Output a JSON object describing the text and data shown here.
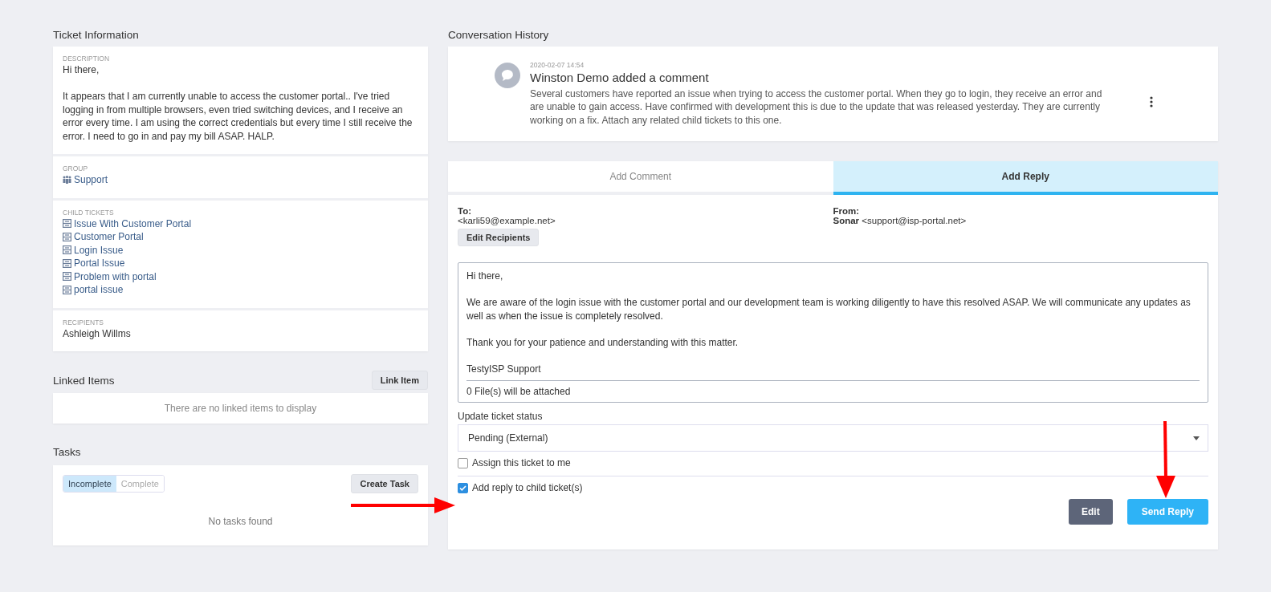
{
  "ticket_information": {
    "title": "Ticket Information",
    "description": {
      "label": "DESCRIPTION",
      "text": "Hi there,\n\nIt appears that I am currently unable to access the customer portal.. I've tried logging in from multiple browsers, even tried switching devices, and I receive an error every time. I am using the correct credentials but every time I still receive the error. I need to go in and pay my bill ASAP. HALP."
    },
    "group": {
      "label": "GROUP",
      "value": "Support"
    },
    "child_tickets": {
      "label": "CHILD TICKETS",
      "items": [
        "Issue With Customer Portal",
        "Customer Portal",
        "Login Issue",
        "Portal Issue",
        "Problem with portal",
        "portal issue"
      ]
    },
    "recipients": {
      "label": "RECIPIENTS",
      "value": "Ashleigh Willms"
    }
  },
  "linked_items": {
    "title": "Linked Items",
    "button": "Link Item",
    "empty": "There are no linked items to display"
  },
  "tasks": {
    "title": "Tasks",
    "filters": [
      {
        "label": "Incomplete",
        "selected": true
      },
      {
        "label": "Complete",
        "selected": false
      }
    ],
    "button": "Create Task",
    "empty": "No tasks found"
  },
  "conversation": {
    "title": "Conversation History",
    "entry": {
      "time": "2020-02-07 14:54",
      "heading": "Winston Demo added a comment",
      "text": "Several customers have reported an issue when trying to access the customer portal. When they go to login, they receive an error and are unable to gain access. Have confirmed with development this is due to the update that was released yesterday. They are currently working on a fix. Attach any related child tickets to this one."
    }
  },
  "reply": {
    "tabs": [
      {
        "label": "Add Comment",
        "selected": false
      },
      {
        "label": "Add Reply",
        "selected": true
      }
    ],
    "to_label": "To:",
    "to": "<karli59@example.net>",
    "edit_recipients": "Edit Recipients",
    "from_label": "From:",
    "from_name": "Sonar",
    "from": "<support@isp-portal.net>",
    "message": "Hi there,\n\nWe are aware of the login issue with the customer portal and our development team is working diligently to have this resolved ASAP. We will communicate any updates as well as when the issue is completely resolved.\n\nThank you for your patience and understanding with this matter.\n\nTestyISP Support",
    "attachments": "0 File(s) will be attached",
    "status_label": "Update ticket status",
    "status": "Pending (External)",
    "options": [
      {
        "label": "Assign this ticket to me",
        "checked": false
      },
      {
        "label": "Add reply to child ticket(s)",
        "checked": true
      }
    ],
    "buttons": [
      {
        "label": "Edit",
        "kind": "secondary"
      },
      {
        "label": "Send Reply",
        "kind": "primary"
      }
    ]
  }
}
